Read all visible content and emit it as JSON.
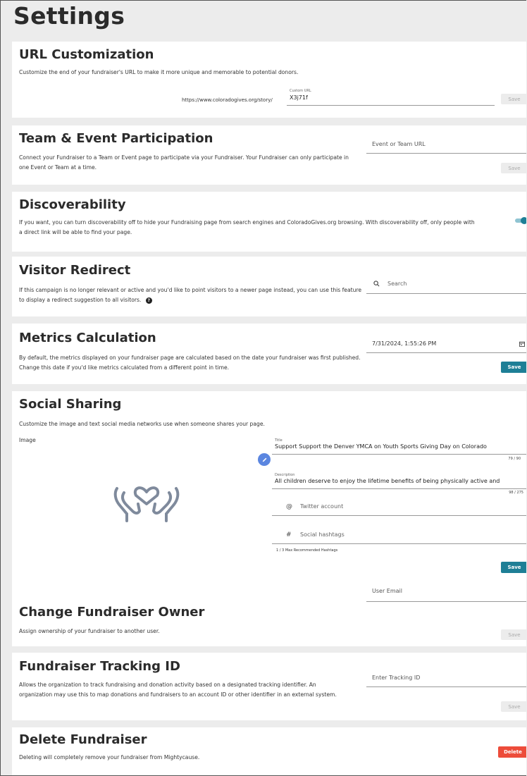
{
  "page": {
    "title": "Settings"
  },
  "url_customization": {
    "title": "URL Customization",
    "description": "Customize the end of your fundraiser's URL to make it more unique and memorable to potential donors.",
    "url_prefix": "https://www.coloradogives.org/story/",
    "field_label": "Custom URL",
    "field_value": "X3j71f",
    "save_label": "Save"
  },
  "team_event": {
    "title": "Team & Event Participation",
    "description": "Connect your Fundraiser to a Team or Event page to participate via your Fundraiser. Your Fundraiser can only participate in one Event or Team at a time.",
    "placeholder": "Event or Team URL",
    "save_label": "Save"
  },
  "discoverability": {
    "title": "Discoverability",
    "description": "If you want, you can turn discoverability off to hide your Fundraising page from search engines and ColoradoGives.org browsing. With discoverability off, only people with a direct link will be able to find your page.",
    "toggle_on": true
  },
  "visitor_redirect": {
    "title": "Visitor Redirect",
    "description": "If this campaign is no longer relevant or active and you'd like to point visitors to a newer page instead, you can use this feature to display a redirect suggestion to all visitors.",
    "search_placeholder": "Search",
    "search_icon": "search-icon",
    "help_icon": "help-circle-icon"
  },
  "metrics": {
    "title": "Metrics Calculation",
    "description": "By default, the metrics displayed on your fundraiser page are calculated based on the date your fundraiser was first published. Change this date if you'd like metrics calculated from a different point in time.",
    "date_value": "7/31/2024, 1:55:26 PM",
    "calendar_icon": "calendar-icon",
    "save_label": "Save"
  },
  "social": {
    "title": "Social Sharing",
    "description": "Customize the image and text social media networks use when someone shares your page.",
    "image_label": "Image",
    "edit_icon": "pencil-icon",
    "image_icon": "heart-hands-icon",
    "title_label": "Title",
    "title_value": "Support Support the Denver YMCA on Youth Sports Giving Day on Colorado",
    "title_count": "79 / 90",
    "description_label": "Description",
    "description_value": "All children deserve to enjoy the lifetime benefits of being physically active and",
    "description_count": "98 / 275",
    "twitter_prefix": "@",
    "twitter_placeholder": "Twitter account",
    "hashtag_prefix": "#",
    "hashtag_placeholder": "Social hashtags",
    "hashtag_hint": "1 / 3 Max Recommended Hashtags",
    "save_label": "Save"
  },
  "owner": {
    "title": "Change Fundraiser Owner",
    "description": "Assign ownership of your fundraiser to another user.",
    "placeholder": "User Email",
    "save_label": "Save"
  },
  "tracking": {
    "title": "Fundraiser Tracking ID",
    "description": "Allows the organization to track fundraising and donation activity based on a designated tracking identifier. An organization may use this to map donations and fundraisers to an account ID or other identifier in an external system.",
    "placeholder": "Enter Tracking ID",
    "save_label": "Save"
  },
  "delete": {
    "title": "Delete Fundraiser",
    "description": "Deleting will completely remove your fundraiser from Mightycause.",
    "delete_label": "Delete"
  },
  "colors": {
    "accent": "#1e7f96",
    "danger": "#ed4c3a",
    "background": "#ececec"
  }
}
